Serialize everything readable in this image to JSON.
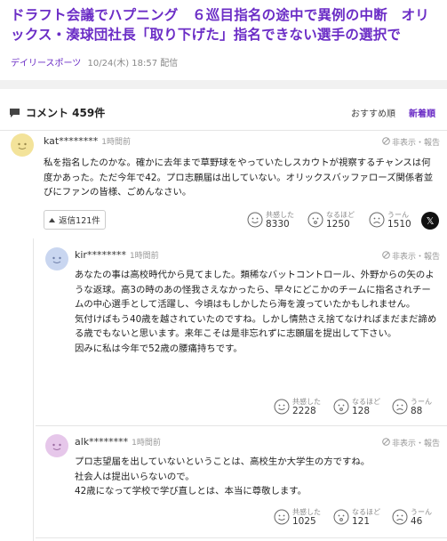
{
  "article": {
    "title": "ドラフト会議でハプニング　６巡目指名の途中で異例の中断　オリックス・湊球団社長「取り下げた」指名できない選手の選択で",
    "source": "デイリースポーツ",
    "date": "10/24(木) 18:57 配信"
  },
  "comments_header": {
    "title": "コメント 459件",
    "sort_recommended": "おすすめ順",
    "sort_newest": "新着順"
  },
  "labels": {
    "hide_report": "非表示・報告",
    "empathy": "共感した",
    "insight": "なるほど",
    "hmm": "うーん"
  },
  "comments": [
    {
      "user": "kat********",
      "time": "1時間前",
      "body": "私を指名したのかな。確かに去年まで草野球をやっていたしスカウトが視察するチャンスは何度かあった。ただ今年で42。プロ志願届は出していない。オリックスバッファローズ関係者並びにファンの皆様、ごめんなさい。",
      "replies_label": "返信121件",
      "empathy": "8330",
      "insight": "1250",
      "hmm": "1510"
    },
    {
      "user": "kir********",
      "time": "1時間前",
      "body": "あなたの事は高校時代から見てました。類稀なバットコントロール、外野からの矢のような返球。高3の時のあの怪我さえなかったら、早々にどこかのチームに指名されチームの中心選手として活躍し、今頃はもしかしたら海を渡っていたかもしれません。\n気付けばもう40歳を越されていたのですね。しかし情熱さえ捨てなければまだまだ諦める歳でもないと思います。来年こそは是非忘れずに志願届を提出して下さい。\n因みに私は今年で52歳の腰痛持ちです。",
      "empathy": "2228",
      "insight": "128",
      "hmm": "88"
    },
    {
      "user": "alk********",
      "time": "1時間前",
      "body": "プロ志望届を出していないということは、高校生か大学生の方ですね。\n社会人は提出いらないので。\n42歳になって学校で学び直しとは、本当に尊敬します。",
      "empathy": "1025",
      "insight": "121",
      "hmm": "46"
    }
  ],
  "colors": {
    "accent": "#6b2dc6",
    "avatar_1": "#f3e39a",
    "avatar_2": "#c9d6f0",
    "avatar_3": "#e6c7ea"
  },
  "icons": [
    "comment-icon",
    "hide-icon",
    "smile-icon",
    "light-icon",
    "frown-icon",
    "x-logo-icon",
    "chevron-up-icon"
  ]
}
